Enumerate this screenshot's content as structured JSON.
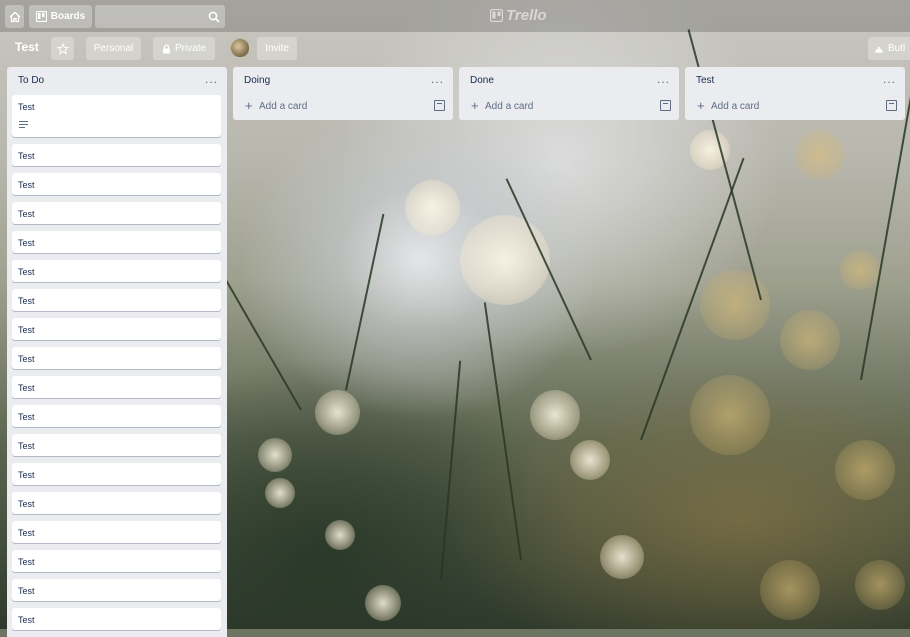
{
  "header": {
    "home_icon": "home-icon",
    "boards_label": "Boards",
    "search_placeholder": "",
    "logo_text": "Trello"
  },
  "board": {
    "title": "Test",
    "visibility_team": "Personal",
    "visibility": "Private",
    "invite_label": "Invite",
    "butler_label": "Butl"
  },
  "lists": [
    {
      "title": "To Do",
      "menu": "...",
      "cards": [
        "Test",
        "Test",
        "Test",
        "Test",
        "Test",
        "Test",
        "Test",
        "Test",
        "Test",
        "Test",
        "Test",
        "Test",
        "Test",
        "Test",
        "Test",
        "Test",
        "Test",
        "Test"
      ]
    },
    {
      "title": "Doing",
      "menu": "...",
      "add_label": "Add a card"
    },
    {
      "title": "Done",
      "menu": "...",
      "add_label": "Add a card"
    },
    {
      "title": "Test",
      "menu": "...",
      "add_label": "Add a card"
    }
  ],
  "colors": {
    "list_bg": "#ebecf0",
    "card_bg": "#ffffff",
    "text": "#172b4d",
    "muted": "#5e6c84"
  }
}
